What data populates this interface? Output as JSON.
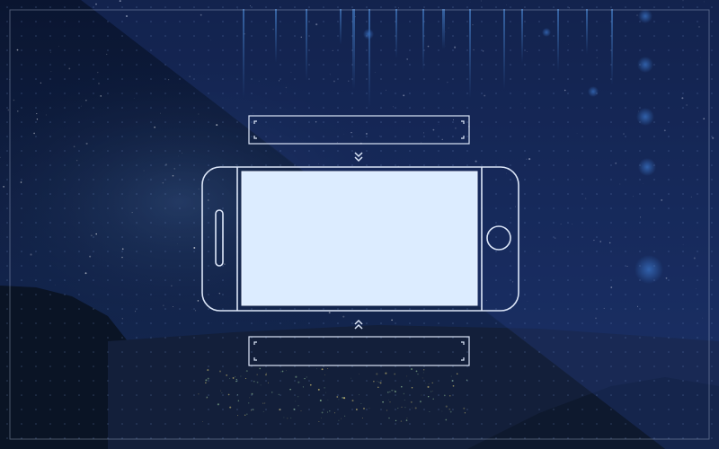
{
  "scene": {
    "colors": {
      "sky_top": "#0b1631",
      "sky_bottom": "#1a2c5a",
      "overlay": "#1d3370",
      "frame_line": "#c8d6f0",
      "screen_fill": "#dcecff",
      "accent_stream": "#3f7fd6"
    },
    "icons": {
      "top_arrow": "double-chevron-down-icon",
      "bottom_arrow": "double-chevron-up-icon",
      "home_button": "circle-home-button-icon"
    }
  }
}
